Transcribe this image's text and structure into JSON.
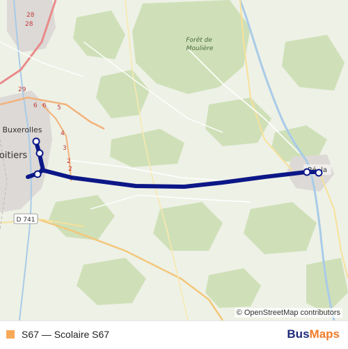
{
  "map": {
    "places": {
      "buxerolles": "Buxerolles",
      "poitiers": "oitiers",
      "foret_line1": "Forêt de",
      "foret_line2": "Moulière",
      "d741": "D 741",
      "nieuil": "Ré..la"
    },
    "route_numbers": {
      "r28a": "28",
      "r28b": "28",
      "r29": "29",
      "r6a": "6",
      "r6b": "6",
      "r5": "5",
      "r4": "4",
      "r3": "3",
      "r2a": "2",
      "r2b": "2"
    },
    "attribution": "© OpenStreetMap contributors",
    "route_color": "#0c1787",
    "stop_fill": "#ffffff"
  },
  "legend": {
    "label": "S67 — Scolaire S67",
    "color": "#f7a95a"
  },
  "brand": {
    "part1": "Bus",
    "part2": "Maps"
  }
}
